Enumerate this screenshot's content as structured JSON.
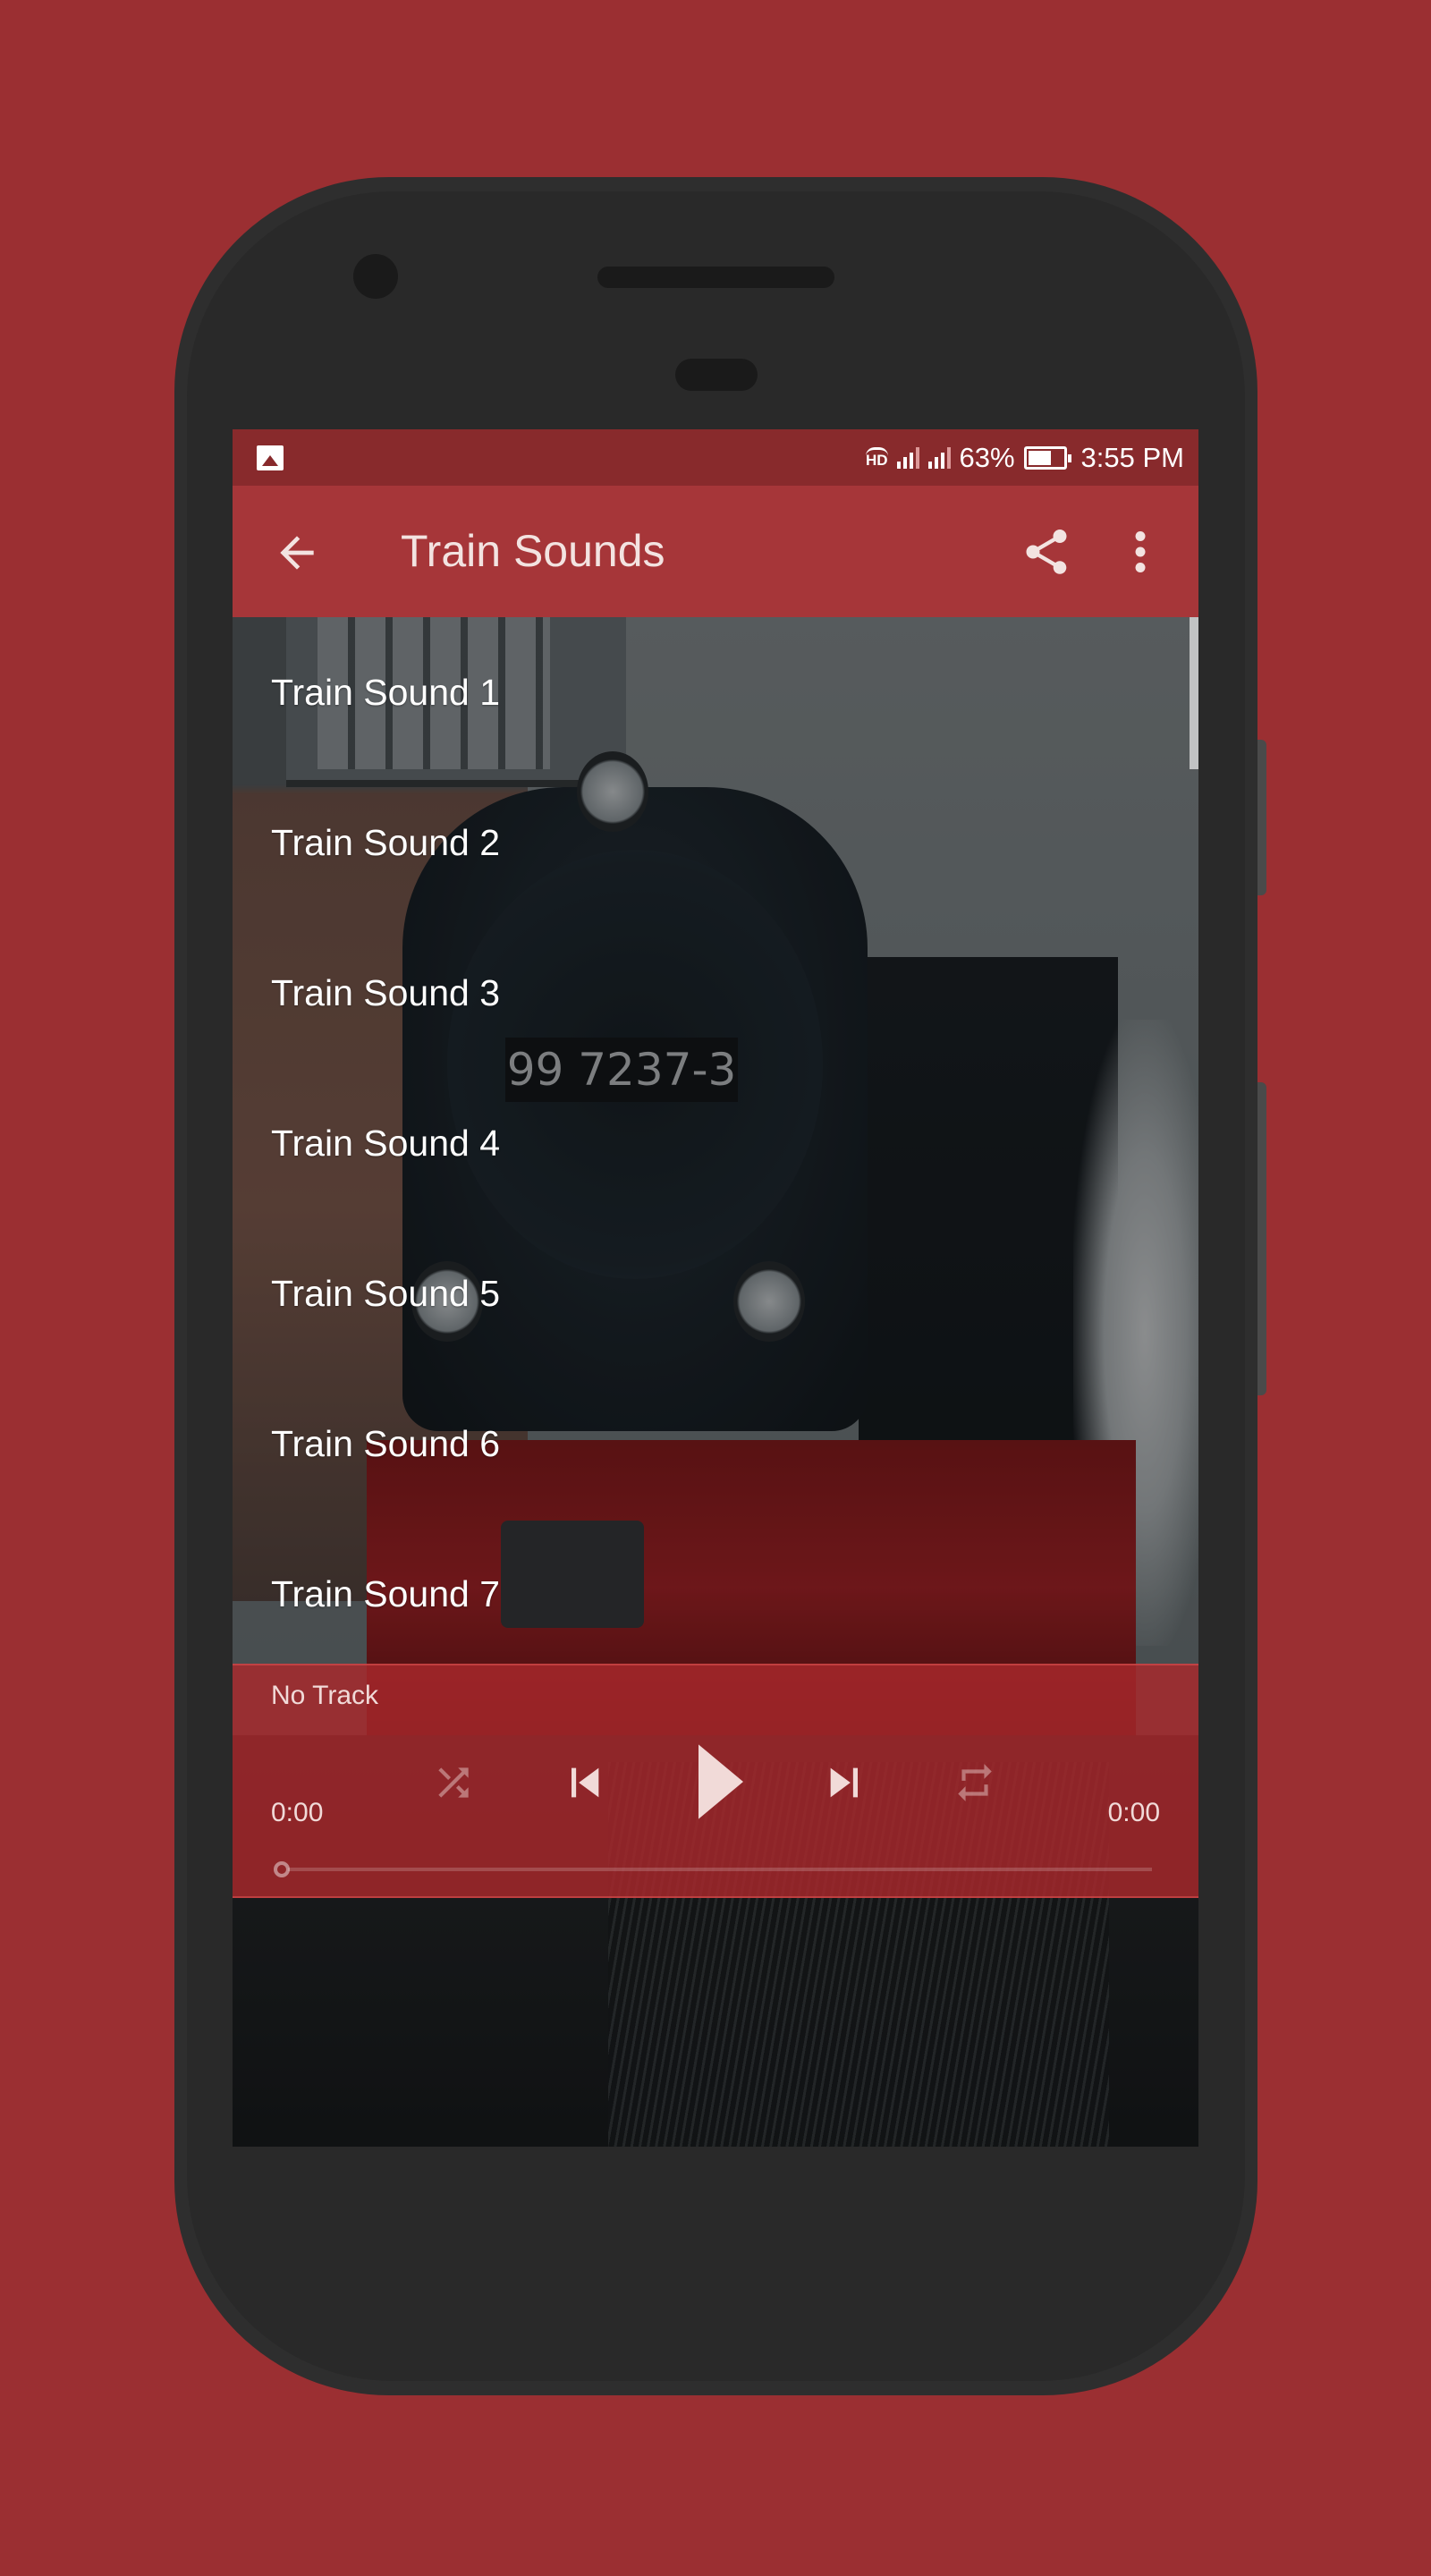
{
  "status_bar": {
    "left_icon": "image-notification-icon",
    "hd_label": "HD",
    "battery_percent": "63%",
    "time": "3:55 PM",
    "icons": [
      "hd-call-icon",
      "signal-sim1-icon",
      "signal-sim2-icon",
      "battery-icon"
    ]
  },
  "app_bar": {
    "title": "Train Sounds",
    "back_icon": "arrow-back-icon",
    "share_icon": "share-icon",
    "more_icon": "more-vert-icon"
  },
  "background": {
    "plate_text": "99 7237-3"
  },
  "tracks": [
    {
      "label": "Train Sound 1"
    },
    {
      "label": "Train Sound 2"
    },
    {
      "label": "Train Sound 3"
    },
    {
      "label": "Train Sound 4"
    },
    {
      "label": "Train Sound 5"
    },
    {
      "label": "Train Sound 6"
    },
    {
      "label": "Train Sound 7"
    }
  ],
  "player": {
    "track_name": "No Track",
    "current_time": "0:00",
    "total_time": "0:00",
    "progress_fraction": 0,
    "controls": [
      "shuffle-icon",
      "skip-previous-icon",
      "play-icon",
      "skip-next-icon",
      "repeat-icon"
    ],
    "shuffle_enabled": false,
    "repeat_enabled": false
  },
  "colors": {
    "page_background": "#9b2f32",
    "status_bar": "#882a2c",
    "app_bar": "#a63639",
    "player_panel": "#aa282c",
    "phone_body": "#2e2e2e"
  }
}
